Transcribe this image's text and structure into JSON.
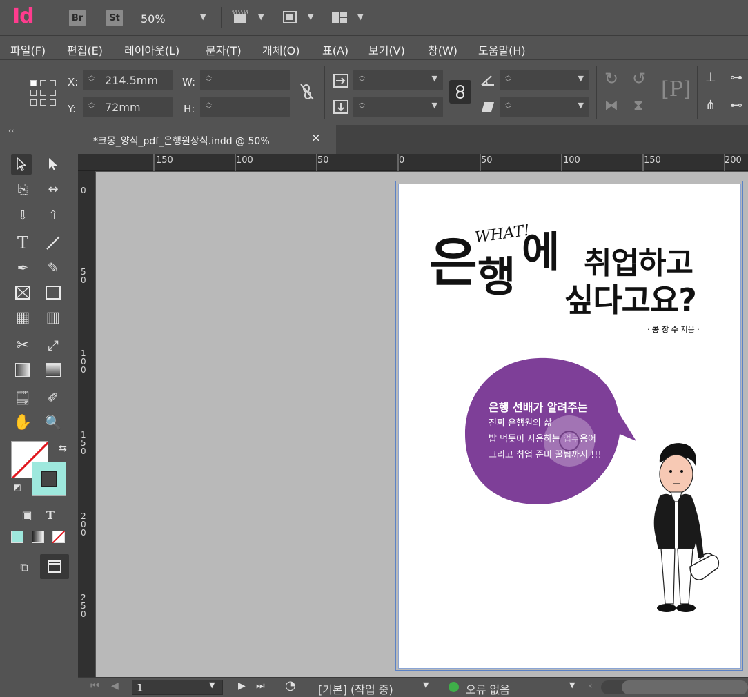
{
  "app": {
    "logo": "Id",
    "bridge_label": "Br",
    "stock_label": "St",
    "zoom": "50%"
  },
  "menu": [
    "파일(F)",
    "편집(E)",
    "레이아웃(L)",
    "문자(T)",
    "개체(O)",
    "표(A)",
    "보기(V)",
    "창(W)",
    "도움말(H)"
  ],
  "control": {
    "x_label": "X:",
    "x_value": "214.5mm",
    "y_label": "Y:",
    "y_value": "72mm",
    "w_label": "W:",
    "w_value": "",
    "h_label": "H:",
    "h_value": ""
  },
  "tab": {
    "title": "*크몽_양식_pdf_은행원상식.indd @ 50%",
    "close": "×"
  },
  "ruler": {
    "h_labels": [
      "150",
      "100",
      "50",
      "0",
      "50",
      "100",
      "150",
      "200"
    ],
    "v_labels": [
      "0",
      "50",
      "100",
      "150",
      "200",
      "250"
    ]
  },
  "document": {
    "what": "WHAT!",
    "big_eun": "은",
    "big_haeng": "행",
    "big_e": "에",
    "title_line1": "취업하고",
    "title_line2": "싶다고요?",
    "author_prefix": "· ",
    "author_name": "콩 장 수",
    "author_suffix": " 지음 ·",
    "bubble_lines": [
      "은행 선배가 알려주는",
      "진짜 은행원의 삶",
      "밥 먹듯이 사용하는 업무용어",
      "그리고 취업 준비 꿀팁까지 !!!"
    ],
    "bubble_color": "#7e3f98"
  },
  "status": {
    "page_number": "1",
    "style": "[기본] (작업 중)",
    "errors": "오류 없음",
    "ok_color": "#3fae49"
  }
}
